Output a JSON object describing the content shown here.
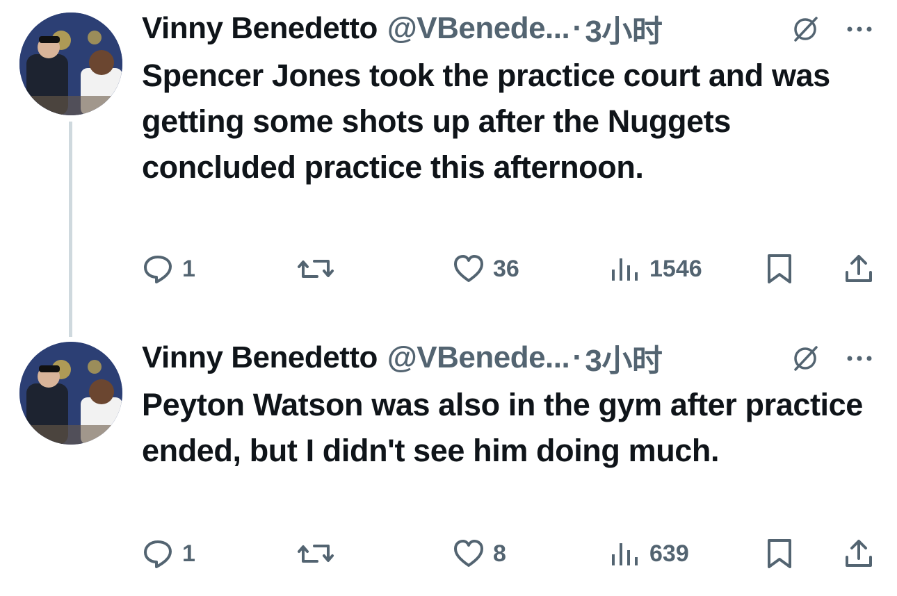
{
  "tweets": [
    {
      "author": {
        "name": "Vinny Benedetto",
        "handle": "@VBenede...",
        "separator": "·",
        "time": "3小时",
        "avatar_icon": "avatar-photo"
      },
      "text": "Spencer Jones took the practice court and was getting some shots up after the Nuggets concluded practice this afternoon.",
      "actions": {
        "replies": "1",
        "retweets": "",
        "likes": "36",
        "views": "1546"
      }
    },
    {
      "author": {
        "name": "Vinny Benedetto",
        "handle": "@VBenede...",
        "separator": "·",
        "time": "3小时",
        "avatar_icon": "avatar-photo"
      },
      "text": "Peyton Watson was also in the gym after practice ended, but I didn't see him doing much.",
      "actions": {
        "replies": "1",
        "retweets": "",
        "likes": "8",
        "views": "639"
      }
    }
  ],
  "colors": {
    "text_primary": "#0f1419",
    "text_secondary": "#536471",
    "thread_line": "#cfd9de",
    "background": "#ffffff"
  },
  "icons": [
    "reply-icon",
    "retweet-icon",
    "like-icon",
    "views-icon",
    "bookmark-icon",
    "share-icon",
    "grok-icon",
    "more-icon"
  ]
}
